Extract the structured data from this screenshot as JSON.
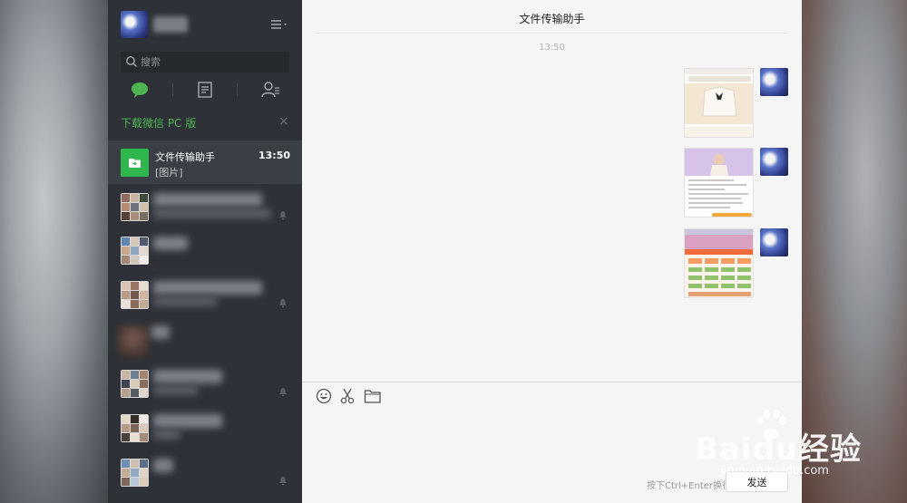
{
  "window": {
    "title": "文件传输助手"
  },
  "sidebar": {
    "search": {
      "placeholder": "搜索"
    },
    "banner": {
      "text": "下载微信 PC 版",
      "close": "×"
    },
    "chats": [
      {
        "title": "文件传输助手",
        "preview": "[图片]",
        "time": "13:50",
        "active": true
      }
    ]
  },
  "conversation": {
    "timestamp": "13:50",
    "messages": [
      {
        "type": "image",
        "from": "self"
      },
      {
        "type": "image",
        "from": "self"
      },
      {
        "type": "image",
        "from": "self"
      }
    ]
  },
  "composer": {
    "hint": "按下Ctrl+Enter换行",
    "send_label": "发送"
  },
  "watermark": {
    "main": "Baidu经验",
    "sub": "jingyan.baidu.com"
  },
  "colors": {
    "accent_green": "#4cb54f",
    "sidebar_bg": "#2e3238",
    "main_bg": "#f5f5f5"
  }
}
